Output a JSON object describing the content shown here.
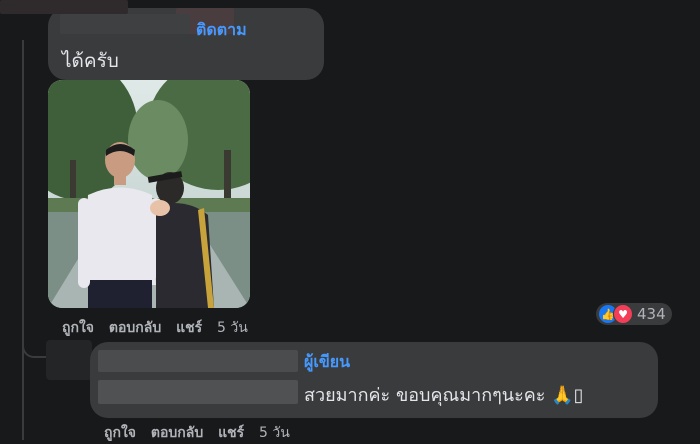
{
  "comment1": {
    "follow_label": "ติดตาม",
    "text": "ได้ครับ",
    "actions": {
      "like": "ถูกใจ",
      "reply": "ตอบกลับ",
      "share": "แชร์",
      "time": "5 วัน"
    },
    "reactions": {
      "count": "434",
      "types": [
        "like-icon",
        "love-icon"
      ]
    }
  },
  "reply1": {
    "author_badge": "ผู้เขียน",
    "text": "สวยมากค่ะ ขอบคุณมากๆนะคะ 🙏▯",
    "actions": {
      "like": "ถูกใจ",
      "reply": "ตอบกลับ",
      "share": "แชร์",
      "time": "5 วัน"
    }
  },
  "colors": {
    "background": "#18191a",
    "bubble": "#3a3b3c",
    "link_blue": "#4599ff",
    "muted": "#b0b3b8"
  }
}
